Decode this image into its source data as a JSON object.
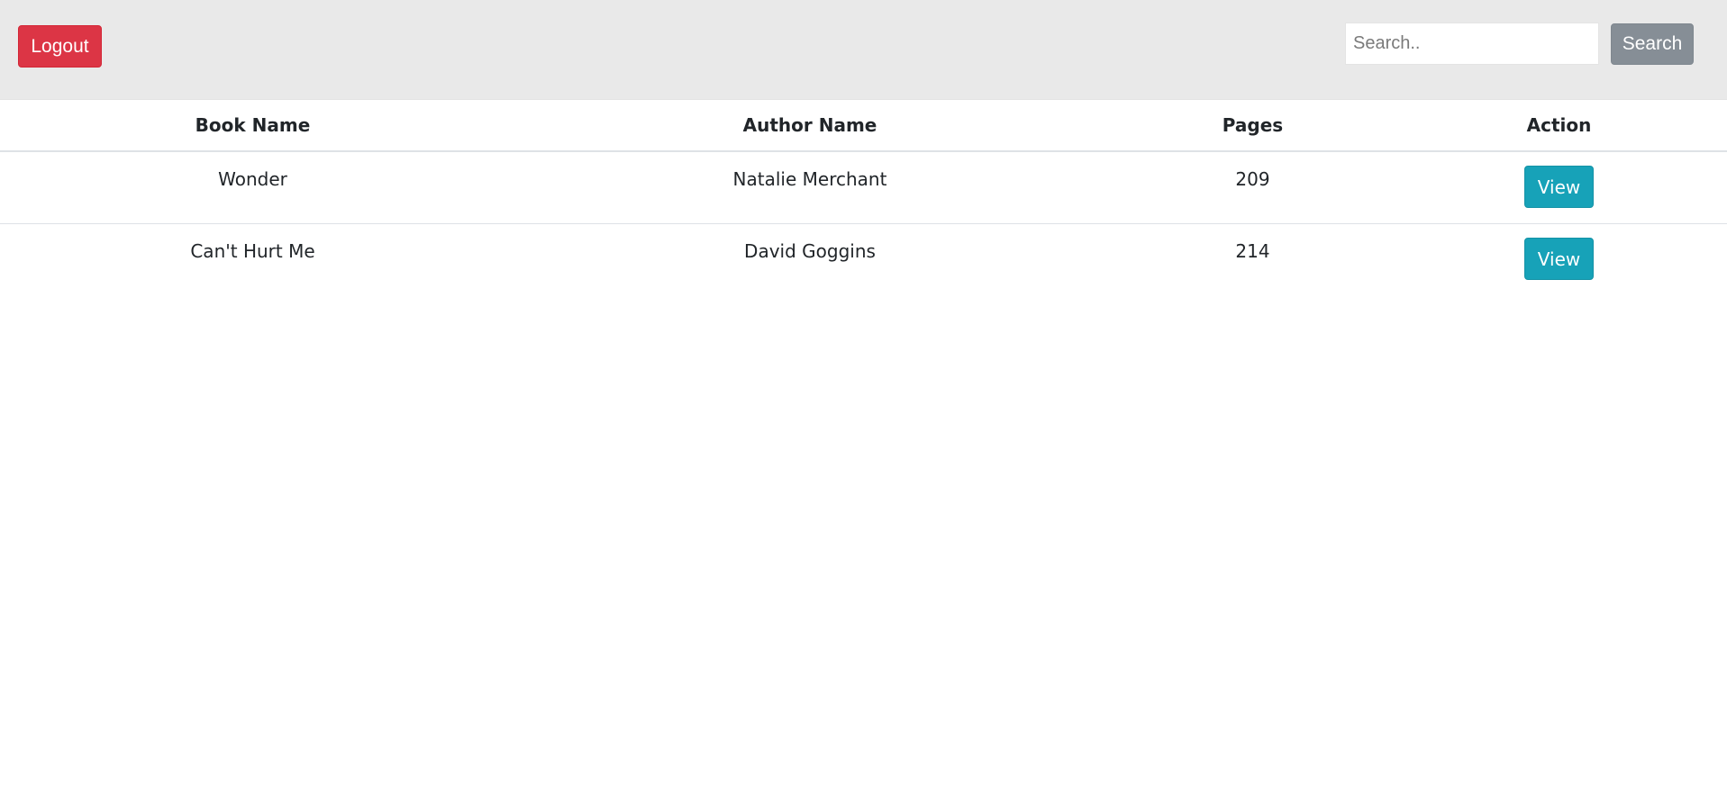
{
  "header": {
    "logout_label": "Logout",
    "search_placeholder": "Search..",
    "search_value": "",
    "search_button_label": "Search"
  },
  "table": {
    "columns": [
      "Book Name",
      "Author Name",
      "Pages",
      "Action"
    ],
    "rows": [
      {
        "book_name": "Wonder",
        "author_name": "Natalie Merchant",
        "pages": "209",
        "action_label": "View"
      },
      {
        "book_name": "Can't Hurt Me",
        "author_name": "David Goggins",
        "pages": "214",
        "action_label": "View"
      }
    ]
  },
  "colors": {
    "logout": "#dc3545",
    "search_button": "#868e96",
    "view_button": "#17a2b8",
    "topbar_bg": "#e9e9e9"
  }
}
